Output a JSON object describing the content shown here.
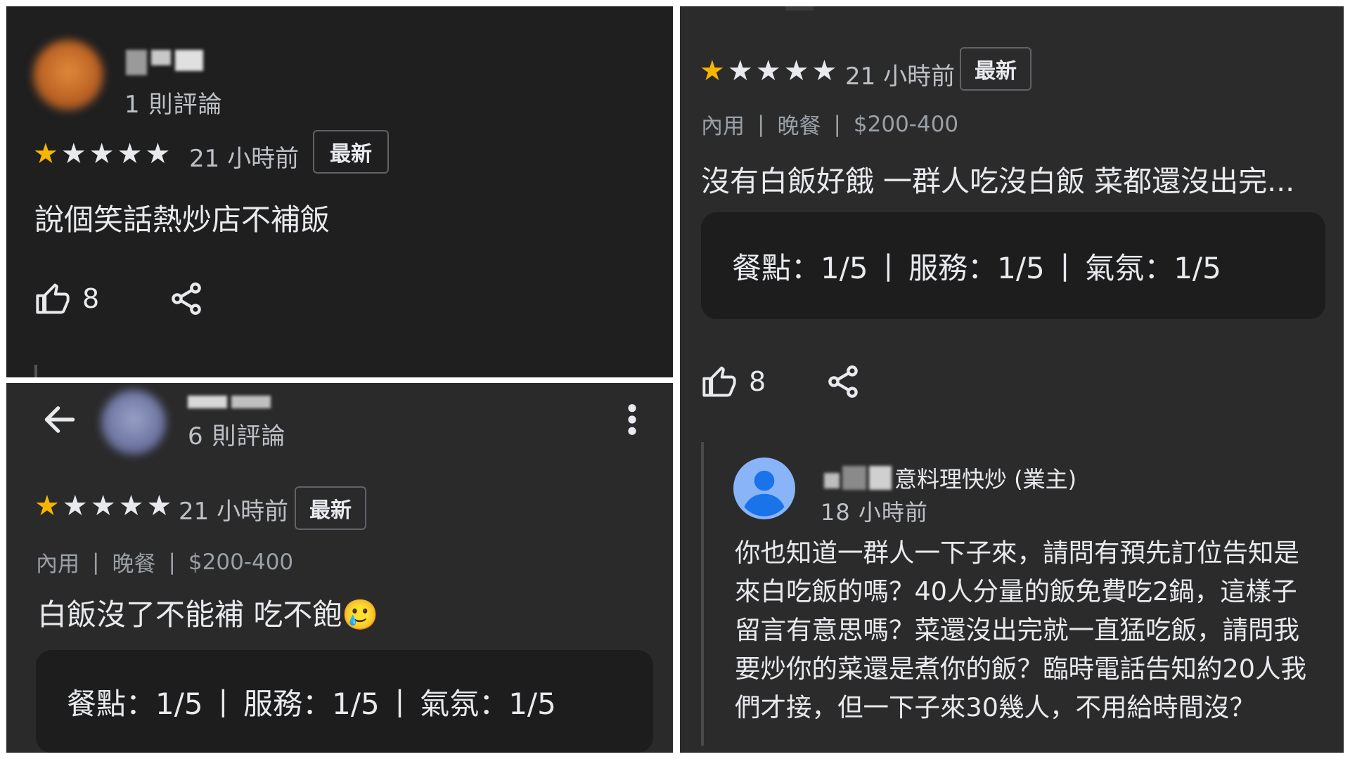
{
  "panel1": {
    "review_count": "1 則評論",
    "time": "21 小時前",
    "badge": "最新",
    "stars_filled": 1,
    "stars_total": 5,
    "review_text": "說個笑話熱炒店不補飯",
    "likes": "8",
    "colors": {
      "star": "#f6b600",
      "background": "#1f1f20"
    },
    "icons": [
      "thumb-up-icon",
      "share-icon"
    ]
  },
  "panel2": {
    "review_count": "6 則評論",
    "time": "21 小時前",
    "badge": "最新",
    "stars_filled": 1,
    "stars_total": 5,
    "meta": [
      "內用",
      "晚餐",
      "$200-400"
    ],
    "review_text": "白飯沒了不能補 吃不飽",
    "emoji": "🥲",
    "ratings": {
      "food_label": "餐點：",
      "food_value": "1/5",
      "service_label": "服務：",
      "service_value": "1/5",
      "atmosphere_label": "氣氛：",
      "atmosphere_value": "1/5"
    },
    "icons": [
      "back-arrow-icon",
      "more-vert-icon"
    ]
  },
  "panel3": {
    "time": "21 小時前",
    "badge": "最新",
    "stars_filled": 1,
    "stars_total": 5,
    "meta": [
      "內用",
      "晚餐",
      "$200-400"
    ],
    "review_text": "沒有白飯好餓 一群人吃沒白飯 菜都還沒出完...",
    "ratings": {
      "food_label": "餐點：",
      "food_value": "1/5",
      "service_label": "服務：",
      "service_value": "1/5",
      "atmosphere_label": "氣氛：",
      "atmosphere_value": "1/5"
    },
    "likes": "8",
    "owner": {
      "name_suffix": "意料理快炒 (業主)",
      "time": "18 小時前",
      "reply_lines": [
        "你也知道一群人一下子來，請問有預先訂位告知是",
        "來白吃飯的嗎？40人分量的飯免費吃2鍋，這樣子",
        "留言有意思嗎？菜還沒出完就一直猛吃飯，請問我",
        "要炒你的菜還是煮你的飯？臨時電話告知約20人我",
        "們才接，但一下子來30幾人，不用給時間沒？"
      ]
    },
    "icons": [
      "thumb-up-icon",
      "share-icon",
      "default-avatar-icon"
    ]
  }
}
